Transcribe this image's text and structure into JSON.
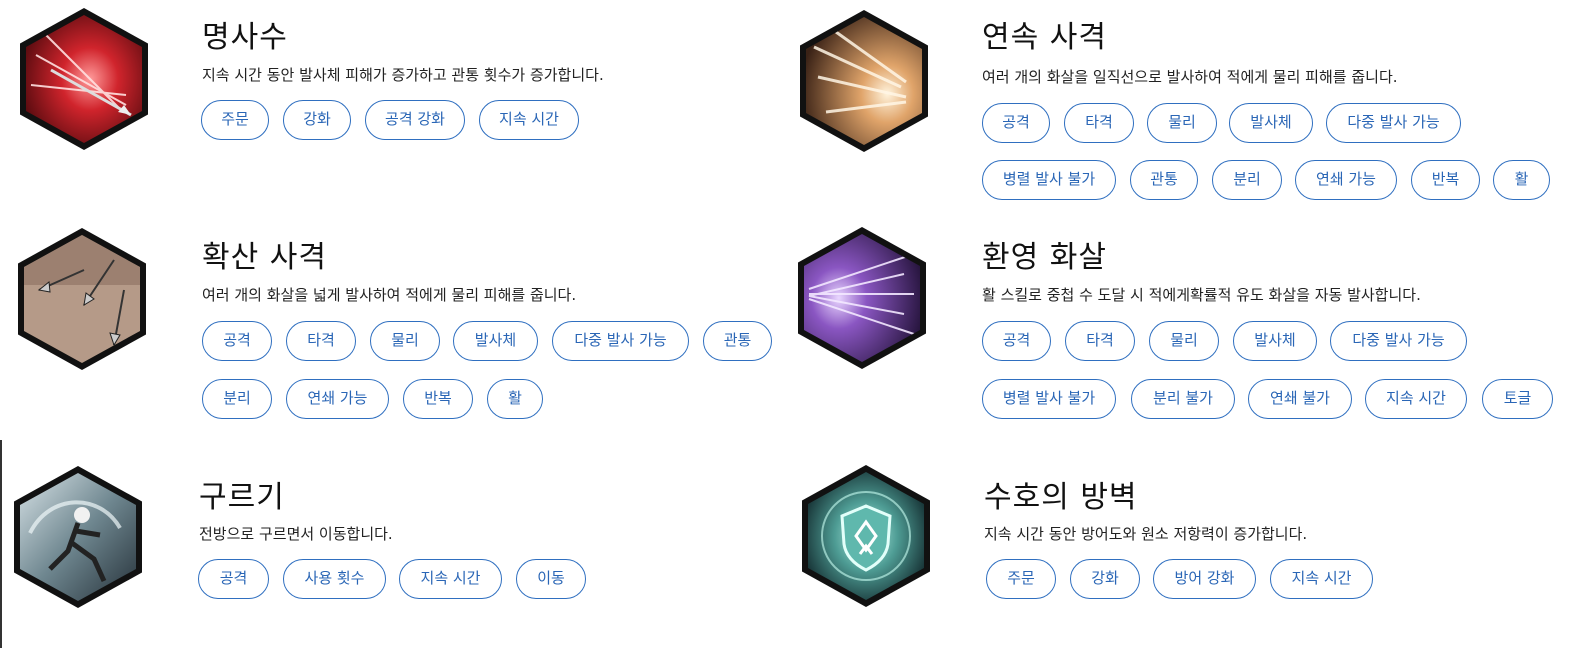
{
  "skills": [
    {
      "name": "명사수",
      "desc": "지속 시간 동안 발사체 피해가 증가하고 관통 횟수가 증가합니다.",
      "icon": "arrow-burst-red-icon",
      "tags": [
        "주문",
        "강화",
        "공격 강화",
        "지속 시간"
      ]
    },
    {
      "name": "연속 사격",
      "desc": "여러 개의 화살을 일직선으로 발사하여 적에게 물리 피해를 줍니다.",
      "icon": "arrow-barrage-gold-icon",
      "tags": [
        "공격",
        "타격",
        "물리",
        "발사체",
        "다중 발사 가능",
        "병렬 발사 불가",
        "관통",
        "분리",
        "연쇄 가능",
        "반복",
        "활"
      ]
    },
    {
      "name": "확산 사격",
      "desc": "여러 개의 화살을 넓게 발사하여 적에게 물리 피해를 줍니다.",
      "icon": "arrow-spread-icon",
      "tags": [
        "공격",
        "타격",
        "물리",
        "발사체",
        "다중 발사 가능",
        "관통",
        "분리",
        "연쇄 가능",
        "반복",
        "활"
      ]
    },
    {
      "name": "환영 화살",
      "desc": "활 스킬로 중첩 수 도달 시 적에게확률적 유도 화살을 자동 발사합니다.",
      "icon": "phantom-arrow-purple-icon",
      "tags": [
        "공격",
        "타격",
        "물리",
        "발사체",
        "다중 발사 가능",
        "병렬 발사 불가",
        "분리 불가",
        "연쇄 불가",
        "지속 시간",
        "토글"
      ]
    },
    {
      "name": "구르기",
      "desc": "전방으로 구르면서 이동합니다.",
      "icon": "dodge-roll-icon",
      "tags": [
        "공격",
        "사용 횟수",
        "지속 시간",
        "이동"
      ]
    },
    {
      "name": "수호의 방벽",
      "desc": "지속 시간 동안 방어도와 원소 저항력이 증가합니다.",
      "icon": "guard-shield-icon",
      "tags": [
        "주문",
        "강화",
        "방어 강화",
        "지속 시간"
      ]
    }
  ],
  "colors": {
    "tag_border": "#2f6fc0",
    "tag_text": "#2a66b6"
  }
}
